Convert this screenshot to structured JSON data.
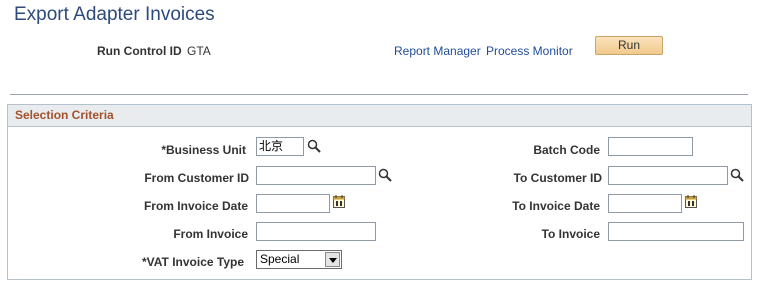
{
  "page": {
    "title": "Export Adapter Invoices"
  },
  "run_control": {
    "label": "Run Control ID",
    "value": "GTA"
  },
  "links": {
    "report_manager": "Report Manager",
    "process_monitor": "Process Monitor"
  },
  "run_button": {
    "label": "Run"
  },
  "selection_criteria": {
    "title": "Selection Criteria",
    "business_unit": {
      "label": "*Business Unit",
      "value": "北京"
    },
    "batch_code": {
      "label": "Batch Code",
      "value": ""
    },
    "from_customer_id": {
      "label": "From Customer ID",
      "value": ""
    },
    "to_customer_id": {
      "label": "To Customer ID",
      "value": ""
    },
    "from_invoice_date": {
      "label": "From Invoice Date",
      "value": ""
    },
    "to_invoice_date": {
      "label": "To Invoice Date",
      "value": ""
    },
    "from_invoice": {
      "label": "From Invoice",
      "value": ""
    },
    "to_invoice": {
      "label": "To Invoice",
      "value": ""
    },
    "vat_invoice_type": {
      "label": "*VAT Invoice Type",
      "selected": "Special"
    }
  },
  "icons": {
    "lookup": "magnifier-icon",
    "calendar": "calendar-icon",
    "dropdown": "chevron-down-icon"
  },
  "colors": {
    "title": "#2d4a7a",
    "link": "#1f4e99",
    "group_title": "#a3522b",
    "run_button": "#f1c98b"
  }
}
